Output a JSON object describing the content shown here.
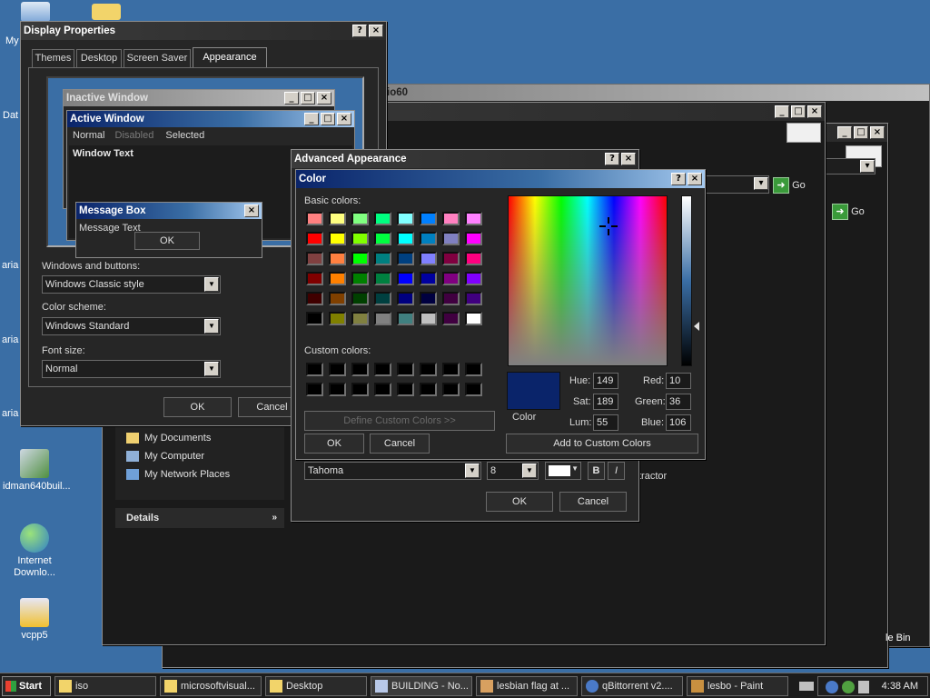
{
  "desktop": {
    "icons": [
      {
        "label": "idman640buil..."
      },
      {
        "label": "Internet Downlo..."
      },
      {
        "label": "vcpp5"
      }
    ],
    "partial_labels": [
      "My",
      "Dat",
      "aria",
      "aria",
      "aria"
    ],
    "recycle_fragment": "le Bin",
    "bg_window_title_fragment": "io60",
    "extractor_fragment": "tractor"
  },
  "explorer_links": [
    "My Documents",
    "My Computer",
    "My Network Places"
  ],
  "details_label": "Details",
  "go_label": "Go",
  "display_properties": {
    "title": "Display Properties",
    "tabs": [
      "Themes",
      "Desktop",
      "Screen Saver",
      "Appearance"
    ],
    "preview": {
      "inactive_title": "Inactive Window",
      "active_title": "Active Window",
      "menu": [
        "Normal",
        "Disabled",
        "Selected"
      ],
      "window_text": "Window Text",
      "message_box_title": "Message Box",
      "message_text": "Message Text",
      "ok": "OK"
    },
    "windows_buttons_label": "Windows and buttons:",
    "windows_buttons_value": "Windows Classic style",
    "color_scheme_label": "Color scheme:",
    "color_scheme_value": "Windows Standard",
    "font_size_label": "Font size:",
    "font_size_value": "Normal",
    "ok": "OK",
    "cancel": "Cancel"
  },
  "advanced_appearance": {
    "title": "Advanced Appearance",
    "font_value": "Tahoma",
    "size_value": "8",
    "bold": "B",
    "italic": "I",
    "ok": "OK",
    "cancel": "Cancel"
  },
  "color_dialog": {
    "title": "Color",
    "basic_colors_label": "Basic colors:",
    "custom_colors_label": "Custom colors:",
    "define_custom": "Define Custom Colors >>",
    "ok": "OK",
    "cancel": "Cancel",
    "add_custom": "Add to Custom Colors",
    "color_label": "Color",
    "hue_label": "Hue:",
    "hue": "149",
    "sat_label": "Sat:",
    "sat": "189",
    "lum_label": "Lum:",
    "lum": "55",
    "red_label": "Red:",
    "red": "10",
    "green_label": "Green:",
    "green": "36",
    "blue_label": "Blue:",
    "blue": "106",
    "selected_color": "#0a246a",
    "basic_colors": [
      "#ff8080",
      "#ffff80",
      "#80ff80",
      "#00ff80",
      "#80ffff",
      "#0080ff",
      "#ff80c0",
      "#ff80ff",
      "#ff0000",
      "#ffff00",
      "#80ff00",
      "#00ff40",
      "#00ffff",
      "#0080c0",
      "#8080c0",
      "#ff00ff",
      "#804040",
      "#ff8040",
      "#00ff00",
      "#008080",
      "#004080",
      "#8080ff",
      "#800040",
      "#ff0080",
      "#800000",
      "#ff8000",
      "#008000",
      "#008040",
      "#0000ff",
      "#0000a0",
      "#800080",
      "#8000ff",
      "#400000",
      "#804000",
      "#004000",
      "#004040",
      "#000080",
      "#000040",
      "#400040",
      "#400080",
      "#000000",
      "#808000",
      "#808040",
      "#808080",
      "#408080",
      "#c0c0c0",
      "#400040",
      "#ffffff"
    ]
  },
  "taskbar": {
    "start": "Start",
    "items": [
      "iso",
      "microsoftvisual...",
      "Desktop",
      "BUILDING - No...",
      "lesbian flag at ...",
      "qBittorrent v2....",
      "lesbo - Paint"
    ],
    "clock": "4:38 AM"
  }
}
